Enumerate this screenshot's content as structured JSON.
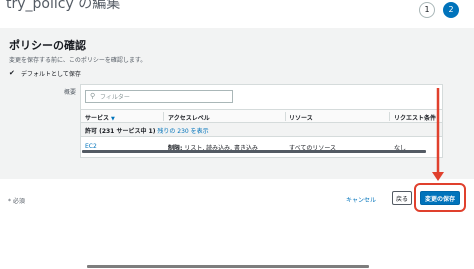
{
  "header": {
    "title": "try_policy の編集",
    "steps": [
      "1",
      "2"
    ]
  },
  "review": {
    "heading": "ポリシーの確認",
    "description": "変更を保存する前に、このポリシーを確認します。",
    "default_checkbox_label": "デフォルトとして保存",
    "summary_label": "概要"
  },
  "table": {
    "filter_placeholder": "フィルター",
    "columns": [
      "サービス",
      "アクセスレベル",
      "リソース",
      "リクエスト条件"
    ],
    "group_prefix": "許可 (231 サービス中 1)",
    "group_link": "残りの 230 を表示",
    "rows": [
      {
        "service": "EC2",
        "access_prefix": "制限:",
        "access_rest": " リスト, 読み込み, 書き込み",
        "resource": "すべてのリソース",
        "condition": "なし"
      }
    ]
  },
  "footer": {
    "required_note": "* 必須",
    "cancel_label": "キャンセル",
    "back_label": "戻る",
    "save_label": "変更の保存"
  },
  "colors": {
    "accent": "#0073bb",
    "annotation": "#e0402d"
  },
  "icons": {
    "search": "search-icon",
    "checkbox": "checkmark-icon",
    "sort": "sort-down-icon"
  }
}
